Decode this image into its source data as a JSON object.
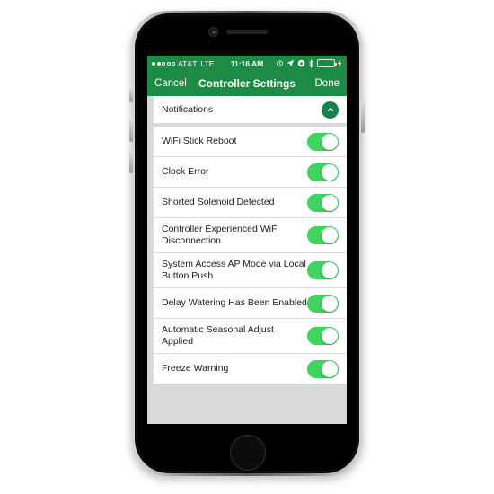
{
  "status_bar": {
    "signal_dots_filled": 2,
    "signal_dots_total": 5,
    "carrier": "AT&T",
    "network": "LTE",
    "time": "11:16 AM",
    "icons": [
      "alarm-clock-icon",
      "location-arrow-icon",
      "rotation-lock-icon",
      "bluetooth-icon",
      "battery-icon",
      "charging-bolt-icon"
    ],
    "battery_level_percent": 100
  },
  "nav_bar": {
    "cancel_label": "Cancel",
    "title": "Controller Settings",
    "done_label": "Done",
    "background_color": "#1d8b46"
  },
  "section_header": {
    "label": "Notifications",
    "collapse_icon": "chevron-up-icon",
    "expanded": true
  },
  "toggle_colors": {
    "on": "#3ed45f",
    "knob": "#ffffff"
  },
  "rows": [
    {
      "label": "WiFi Stick Reboot",
      "enabled": true
    },
    {
      "label": "Clock Error",
      "enabled": true
    },
    {
      "label": "Shorted Solenoid Detected",
      "enabled": true
    },
    {
      "label": "Controller Experienced WiFi Disconnection",
      "enabled": true
    },
    {
      "label": "System Access AP Mode via Local Button Push",
      "enabled": true
    },
    {
      "label": "Delay Watering Has Been Enabled",
      "enabled": true
    },
    {
      "label": "Automatic Seasonal Adjust Applied",
      "enabled": true
    },
    {
      "label": "Freeze Warning",
      "enabled": true
    }
  ]
}
